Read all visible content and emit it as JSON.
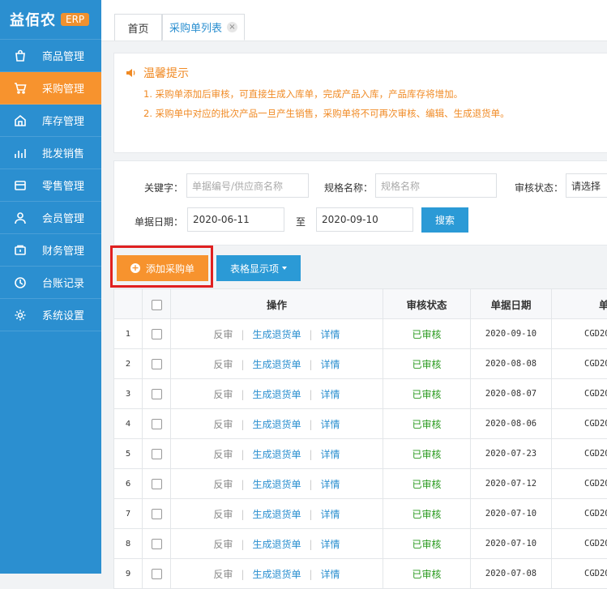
{
  "brand": {
    "name": "益佰农",
    "badge": "ERP"
  },
  "sidebar": {
    "items": [
      {
        "label": "商品管理",
        "icon": "shopping-bag-icon"
      },
      {
        "label": "采购管理",
        "icon": "cart-icon",
        "active": true
      },
      {
        "label": "库存管理",
        "icon": "warehouse-icon"
      },
      {
        "label": "批发销售",
        "icon": "chart-icon"
      },
      {
        "label": "零售管理",
        "icon": "store-icon"
      },
      {
        "label": "会员管理",
        "icon": "user-icon"
      },
      {
        "label": "财务管理",
        "icon": "wallet-icon"
      },
      {
        "label": "台账记录",
        "icon": "clock-icon"
      },
      {
        "label": "系统设置",
        "icon": "gear-icon"
      }
    ]
  },
  "tabs": {
    "home": "首页",
    "active": "采购单列表",
    "close": "×"
  },
  "notice": {
    "title": "温馨提示",
    "line1": "1. 采购单添加后审核，可直接生成入库单，完成产品入库，产品库存将增加。",
    "line2": "2. 采购单中对应的批次产品一旦产生销售，采购单将不可再次审核、编辑、生成退货单。"
  },
  "filter": {
    "keyword_label": "关键字：",
    "keyword_placeholder": "单据编号/供应商名称",
    "spec_label": "规格名称：",
    "spec_placeholder": "规格名称",
    "status_label": "审核状态：",
    "status_value": "请选择",
    "date_label": "单据日期：",
    "date_from": "2020-06-11",
    "date_to_label": "至",
    "date_to": "2020-09-10",
    "search_label": "搜索"
  },
  "toolbar": {
    "add_label": "添加采购单",
    "columns_label": "表格显示项"
  },
  "table": {
    "headers": {
      "action": "操作",
      "status": "审核状态",
      "date": "单据日期",
      "code": "单"
    },
    "rows": [
      {
        "idx": "1",
        "a1": "反审",
        "a2": "生成退货单",
        "a3": "详情",
        "status": "已审核",
        "date": "2020-09-10",
        "code": "CGD20"
      },
      {
        "idx": "2",
        "a1": "反审",
        "a2": "生成退货单",
        "a3": "详情",
        "status": "已审核",
        "date": "2020-08-08",
        "code": "CGD20"
      },
      {
        "idx": "3",
        "a1": "反审",
        "a2": "生成退货单",
        "a3": "详情",
        "status": "已审核",
        "date": "2020-08-07",
        "code": "CGD20"
      },
      {
        "idx": "4",
        "a1": "反审",
        "a2": "生成退货单",
        "a3": "详情",
        "status": "已审核",
        "date": "2020-08-06",
        "code": "CGD20"
      },
      {
        "idx": "5",
        "a1": "反审",
        "a2": "生成退货单",
        "a3": "详情",
        "status": "已审核",
        "date": "2020-07-23",
        "code": "CGD20"
      },
      {
        "idx": "6",
        "a1": "反审",
        "a2": "生成退货单",
        "a3": "详情",
        "status": "已审核",
        "date": "2020-07-12",
        "code": "CGD20"
      },
      {
        "idx": "7",
        "a1": "反审",
        "a2": "生成退货单",
        "a3": "详情",
        "status": "已审核",
        "date": "2020-07-10",
        "code": "CGD20"
      },
      {
        "idx": "8",
        "a1": "反审",
        "a2": "生成退货单",
        "a3": "详情",
        "status": "已审核",
        "date": "2020-07-10",
        "code": "CGD20"
      },
      {
        "idx": "9",
        "a1": "反审",
        "a2": "生成退货单",
        "a3": "详情",
        "status": "已审核",
        "date": "2020-07-08",
        "code": "CGD20"
      }
    ]
  }
}
